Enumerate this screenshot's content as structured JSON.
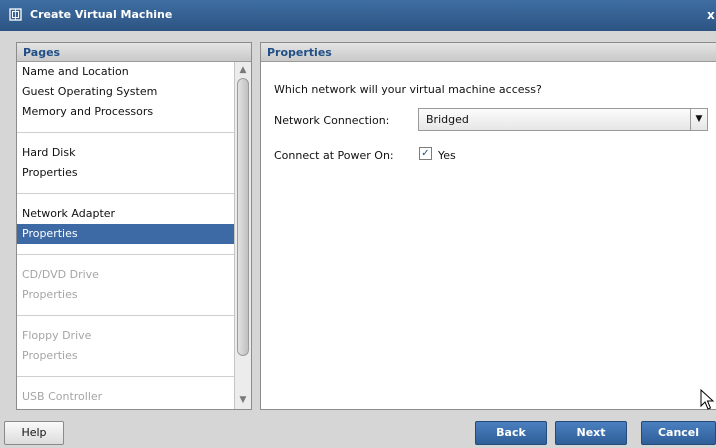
{
  "window": {
    "title": "Create Virtual Machine",
    "close_glyph": "x"
  },
  "left_panel": {
    "header": "Pages",
    "groups": [
      {
        "items": [
          {
            "label": "Name and Location",
            "state": "enabled"
          },
          {
            "label": "Guest Operating System",
            "state": "enabled"
          },
          {
            "label": "Memory and Processors",
            "state": "enabled"
          }
        ]
      },
      {
        "items": [
          {
            "label": "Hard Disk",
            "state": "enabled"
          },
          {
            "label": "Properties",
            "state": "enabled"
          }
        ]
      },
      {
        "items": [
          {
            "label": "Network Adapter",
            "state": "enabled"
          },
          {
            "label": "Properties",
            "state": "selected"
          }
        ]
      },
      {
        "items": [
          {
            "label": "CD/DVD Drive",
            "state": "disabled"
          },
          {
            "label": "Properties",
            "state": "disabled"
          }
        ]
      },
      {
        "items": [
          {
            "label": "Floppy Drive",
            "state": "disabled"
          },
          {
            "label": "Properties",
            "state": "disabled"
          }
        ]
      },
      {
        "items": [
          {
            "label": "USB Controller",
            "state": "disabled"
          }
        ]
      }
    ]
  },
  "right_panel": {
    "header": "Properties",
    "question": "Which network will your virtual machine access?",
    "network_connection": {
      "label": "Network Connection:",
      "value": "Bridged"
    },
    "connect_power_on": {
      "label": "Connect at Power On:",
      "checked": true,
      "check_label": "Yes"
    }
  },
  "buttons": {
    "help": "Help",
    "back": "Back",
    "next": "Next",
    "cancel": "Cancel"
  },
  "colors": {
    "title_bar": "#2f5a8c",
    "selection": "#3d6aa5",
    "header_text": "#1f4f86",
    "primary_button": "#3a6dab",
    "disabled_text": "#a5a5a5"
  },
  "icons": {
    "title": "window-icon",
    "scroll_up": "chevron-up-icon",
    "scroll_down": "chevron-down-icon",
    "dropdown": "dropdown-arrow-icon",
    "check": "checkmark-icon",
    "cursor": "mouse-pointer-icon"
  }
}
